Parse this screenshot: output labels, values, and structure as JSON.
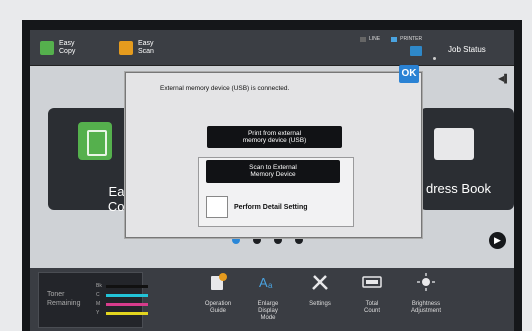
{
  "topbar": {
    "modes": [
      {
        "label": "Easy\nCopy",
        "color": "#55b04d"
      },
      {
        "label": "Easy\nScan",
        "color": "#e59b1e"
      }
    ],
    "line_label": "LINE",
    "printer_label": "PRINTER",
    "job_status": "Job Status"
  },
  "home": {
    "tile_left_label": "Easy\nCopy",
    "tile_right_label": "dress Book",
    "pager_count": 4,
    "pager_active": 0
  },
  "dialog": {
    "message": "External memory device (USB) is connected.",
    "ok_label": "OK",
    "print_button": "Print from external\nmemory device (USB)",
    "scan_button": "Scan to External\nMemory Device",
    "detail_label": "Perform Detail Setting"
  },
  "bottombar": {
    "toner_label": "Toner\nRemaining",
    "toner": [
      {
        "key": "Bk",
        "color": "#111111"
      },
      {
        "key": "C",
        "color": "#22c4d8"
      },
      {
        "key": "M",
        "color": "#d83c8c"
      },
      {
        "key": "Y",
        "color": "#e3d51f"
      }
    ],
    "functions": [
      {
        "label": "Operation\nGuide",
        "icon": "book-icon"
      },
      {
        "label": "Enlarge\nDisplay\nMode",
        "icon": "enlarge-text-icon"
      },
      {
        "label": "Settings",
        "icon": "tools-icon"
      },
      {
        "label": "Total\nCount",
        "icon": "counter-icon"
      },
      {
        "label": "Brightness\nAdjustment",
        "icon": "brightness-icon"
      }
    ]
  }
}
